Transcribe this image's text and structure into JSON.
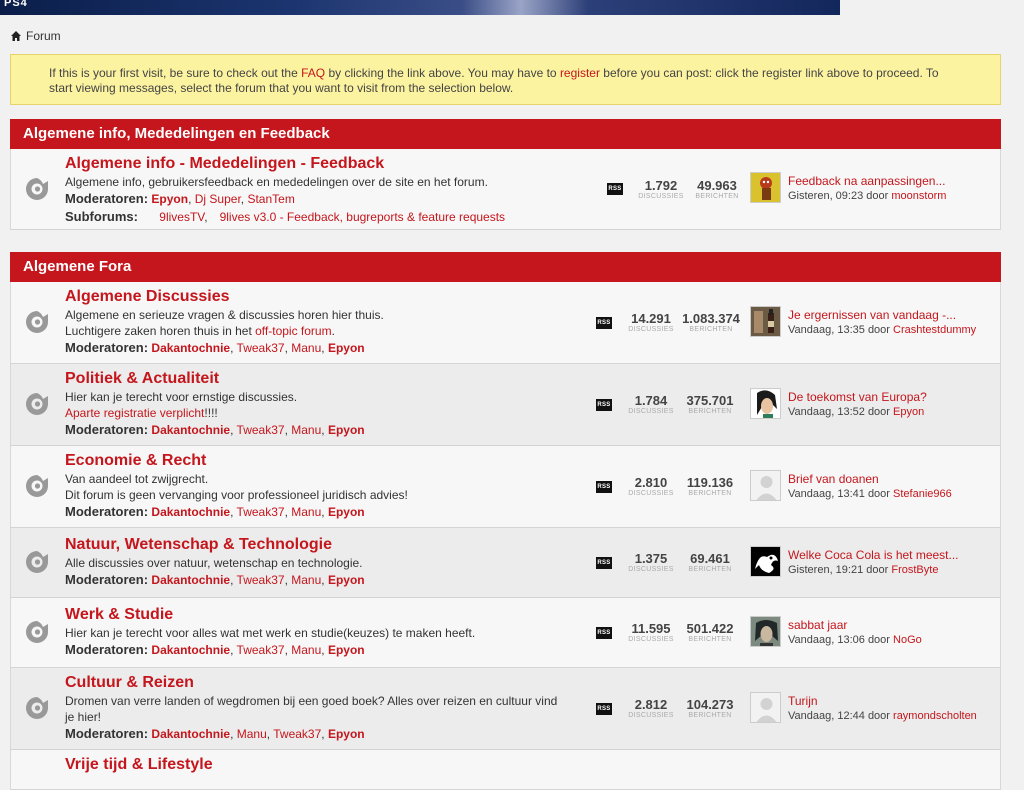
{
  "banner": {
    "logo": "PS4"
  },
  "breadcrumb": {
    "label": "Forum"
  },
  "notice": {
    "p1": "If this is your first visit, be sure to check out the ",
    "faq": "FAQ",
    "p2": " by clicking the link above. You may have to ",
    "register": "register",
    "p3": " before you can post: click the register link above to proceed. To start viewing messages, select the forum that you want to visit from the selection below."
  },
  "labels": {
    "moderators": "Moderatoren:",
    "subforums": "Subforums:",
    "discussions": "DISCUSSIES",
    "posts": "BERICHTEN",
    "rss": "RSS",
    "by": "door"
  },
  "sections": [
    {
      "title": "Algemene info, Mededelingen en Feedback",
      "forums": [
        {
          "title": "Algemene info - Mededelingen - Feedback",
          "desc": "Algemene info, gebruikersfeedback en mededelingen over de site en het forum.",
          "mods": [
            "Epyon",
            "Dj Super",
            "StanTem"
          ],
          "subforums": [
            "9livesTV",
            "9lives v3.0 - Feedback, bugreports & feature requests"
          ],
          "discussions": "1.792",
          "posts": "49.963",
          "last": {
            "title": "Feedback na aanpassingen...",
            "time": "Gisteren, 09:23",
            "user": "moonstorm"
          }
        }
      ]
    },
    {
      "title": "Algemene Fora",
      "forums": [
        {
          "title": "Algemene Discussies",
          "desc1": "Algemene en serieuze vragen & discussies horen hier thuis.",
          "desc2a": "Luchtigere zaken horen thuis in het ",
          "desc2link": "off-topic forum",
          "desc2b": ".",
          "mods": [
            "Dakantochnie",
            "Tweak37",
            "Manu",
            "Epyon"
          ],
          "discussions": "14.291",
          "posts": "1.083.374",
          "last": {
            "title": "Je ergernissen van vandaag -...",
            "time": "Vandaag, 13:35",
            "user": "Crashtestdummy"
          }
        },
        {
          "title": "Politiek & Actualiteit",
          "desc1": "Hier kan je terecht voor ernstige discussies.",
          "desc2link": "Aparte registratie verplicht",
          "desc2b": "!!!!",
          "mods": [
            "Dakantochnie",
            "Tweak37",
            "Manu",
            "Epyon"
          ],
          "discussions": "1.784",
          "posts": "375.701",
          "last": {
            "title": "De toekomst van Europa?",
            "time": "Vandaag, 13:52",
            "user": "Epyon"
          }
        },
        {
          "title": "Economie & Recht",
          "desc1": "Van aandeel tot zwijgrecht.",
          "desc2": "Dit forum is geen vervanging voor professioneel juridisch advies!",
          "mods": [
            "Dakantochnie",
            "Tweak37",
            "Manu",
            "Epyon"
          ],
          "discussions": "2.810",
          "posts": "119.136",
          "last": {
            "title": "Brief van doanen",
            "time": "Vandaag, 13:41",
            "user": "Stefanie966"
          }
        },
        {
          "title": "Natuur, Wetenschap & Technologie",
          "desc1": "Alle discussies over natuur, wetenschap en technologie.",
          "mods": [
            "Dakantochnie",
            "Tweak37",
            "Manu",
            "Epyon"
          ],
          "discussions": "1.375",
          "posts": "69.461",
          "last": {
            "title": "Welke Coca Cola is het meest...",
            "time": "Gisteren, 19:21",
            "user": "FrostByte"
          }
        },
        {
          "title": "Werk & Studie",
          "desc1": "Hier kan je terecht voor alles wat met werk en studie(keuzes) te maken heeft.",
          "mods": [
            "Dakantochnie",
            "Tweak37",
            "Manu",
            "Epyon"
          ],
          "discussions": "11.595",
          "posts": "501.422",
          "last": {
            "title": "sabbat jaar",
            "time": "Vandaag, 13:06",
            "user": "NoGo"
          }
        },
        {
          "title": "Cultuur & Reizen",
          "desc1": "Dromen van verre landen of wegdromen bij een goed boek? Alles over reizen en cultuur vind je hier!",
          "mods": [
            "Dakantochnie",
            "Manu",
            "Tweak37",
            "Epyon"
          ],
          "discussions": "2.812",
          "posts": "104.273",
          "last": {
            "title": "Turijn",
            "time": "Vandaag, 12:44",
            "user": "raymondscholten"
          }
        },
        {
          "title": "Vrije tijd & Lifestyle"
        }
      ]
    }
  ]
}
